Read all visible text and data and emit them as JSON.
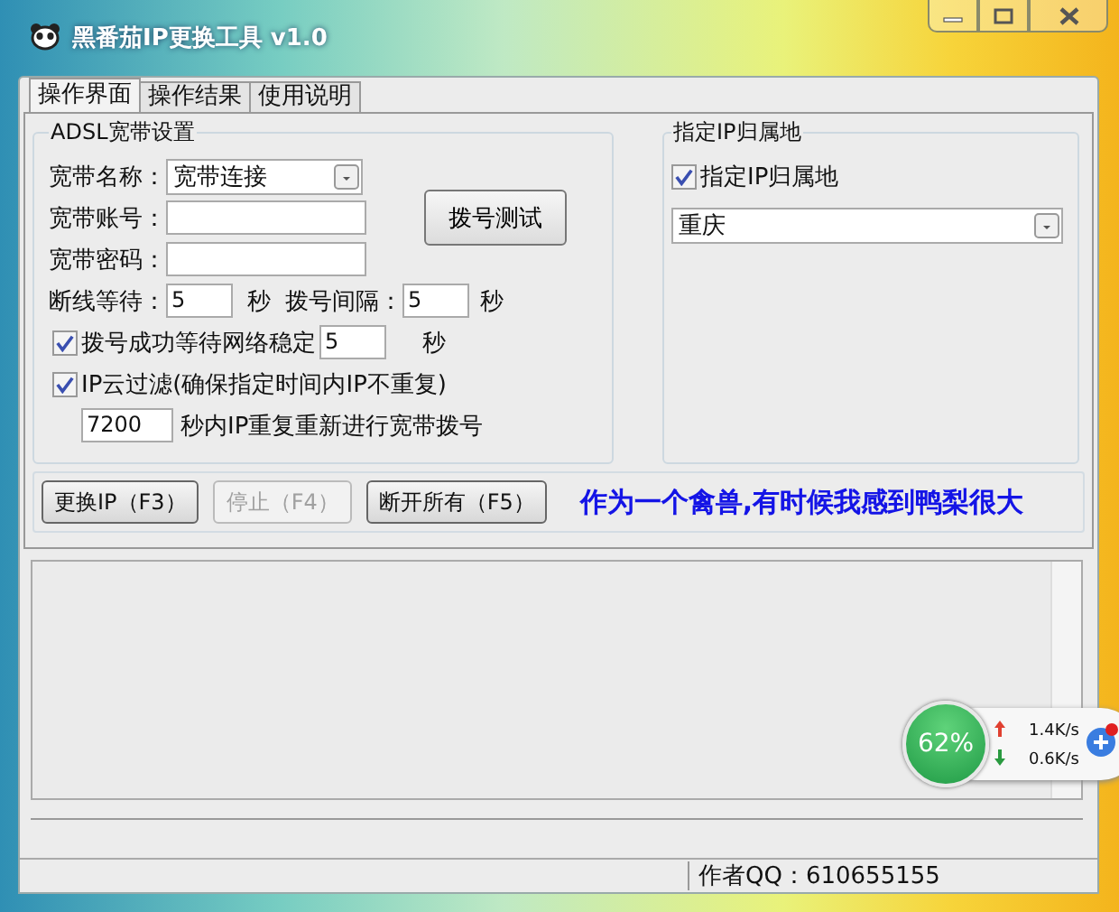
{
  "window": {
    "title": "黑番茄IP更换工具 v1.0"
  },
  "tabs": [
    {
      "label": "操作界面",
      "selected": true
    },
    {
      "label": "操作结果",
      "selected": false
    },
    {
      "label": "使用说明",
      "selected": false
    }
  ],
  "adsl_group": {
    "title": "ADSL宽带设置",
    "name_label": "宽带名称：",
    "name_value": "宽带连接",
    "account_label": "宽带账号：",
    "password_label": "宽带密码：",
    "disconnect_wait_label": "断线等待：",
    "disconnect_wait_value": "5",
    "disconnect_wait_unit": "秒",
    "dial_interval_label": "拨号间隔：",
    "dial_interval_value": "5",
    "dial_interval_unit": "秒",
    "dial_test_button": "拨号测试",
    "stable_wait": {
      "label": "拨号成功等待网络稳定",
      "checked": true,
      "value": "5",
      "unit": "秒"
    },
    "ip_filter": {
      "label": "IP云过滤(确保指定时间内IP不重复)",
      "checked": true,
      "value": "7200",
      "suffix": "秒内IP重复重新进行宽带拨号"
    }
  },
  "location_group": {
    "title": "指定IP归属地",
    "checkbox": {
      "label": "指定IP归属地",
      "checked": true
    },
    "city": "重庆"
  },
  "buttons": [
    {
      "label": "更换IP（F3）",
      "disabled": false
    },
    {
      "label": "停止（F4）",
      "disabled": true
    },
    {
      "label": "断开所有（F5）",
      "disabled": false
    }
  ],
  "slogan": "作为一个禽兽,有时候我感到鸭梨很大",
  "status_bar": {
    "author": "作者QQ：610655155"
  },
  "speed_widget": {
    "percent": "62%",
    "upload": "1.4K/s",
    "download": "0.6K/s"
  }
}
